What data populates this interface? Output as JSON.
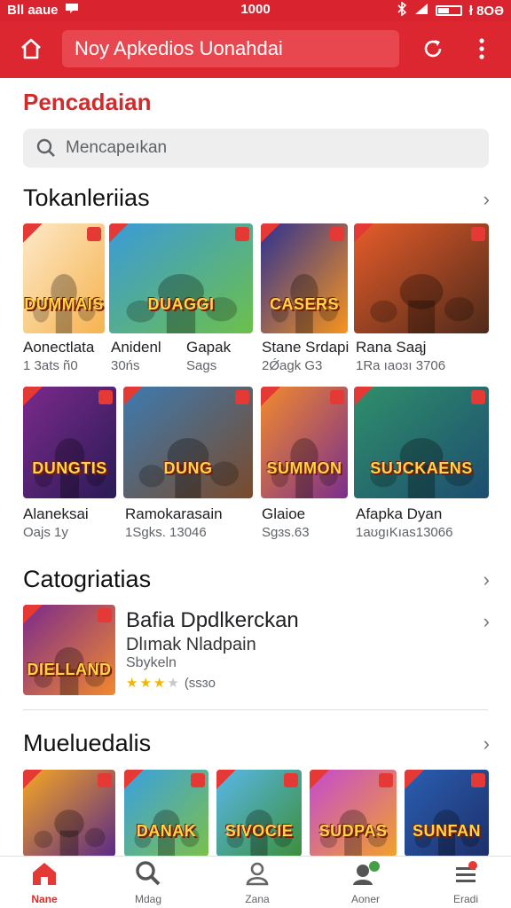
{
  "status_bar": {
    "carrier": "Bll aaue",
    "time": "1000",
    "battery_text": "ł 8OƏ"
  },
  "toolbar": {
    "url_text": "Noy Apkedios Uonahdai"
  },
  "page": {
    "title": "Pencadaian"
  },
  "search": {
    "placeholder": "Mencapeıkan"
  },
  "sections": {
    "top": {
      "title": "Tokanleriias"
    },
    "categories": {
      "title": "Catogriatias"
    },
    "more": {
      "title": "Mueluedalis"
    }
  },
  "apps_row1": [
    {
      "name": "Aonectlata",
      "meta": "1 3ats ñ0",
      "tile_text": "DUMMAIS",
      "colors": [
        "#fde9c8",
        "#f6b34f"
      ]
    },
    {
      "name": "Anidenl",
      "meta": "30ńs",
      "tile_text": "DUAGGI",
      "colors": [
        "#3a9ad9",
        "#6cc04a"
      ]
    },
    {
      "name": "Gapak",
      "meta": "Sags",
      "tile_text": "",
      "colors": [
        "#3a9ad9",
        "#6cc04a"
      ]
    },
    {
      "name": "Stane Srdapi",
      "meta": "2Ǿagk G3",
      "tile_text": "CASERS",
      "colors": [
        "#2e3192",
        "#f7941d"
      ]
    },
    {
      "name": "Rana Saąj",
      "meta": "1Ra ıaoɜı 3706",
      "tile_text": "",
      "colors": [
        "#e65c2a",
        "#4e2a1a"
      ]
    }
  ],
  "apps_row2": [
    {
      "name": "Alaneksai",
      "meta": "Oajs 1y",
      "tile_text": "DUNGTIS",
      "colors": [
        "#7b2a8c",
        "#2a1b55"
      ]
    },
    {
      "name": "Ramokarasain",
      "meta": "1Sgks. 13046",
      "tile_text": "DUNG",
      "colors": [
        "#3d7bb0",
        "#7a4a2a"
      ]
    },
    {
      "name": "Glaioe",
      "meta": "Sgɜs.63",
      "tile_text": "SUMMON",
      "colors": [
        "#f28a2e",
        "#7b2f8c"
      ]
    },
    {
      "name": "Afapka Dyan",
      "meta": "1aʊgıKıas13066",
      "tile_text": "SUJCKAENS",
      "colors": [
        "#2f8f6a",
        "#1d4d70"
      ]
    }
  ],
  "featured": {
    "name": "Bafia Dpdlkerckan",
    "subtitle": "Dlımak Nladpain",
    "category": "Sbykeln",
    "rating_text": "(ssɜo",
    "thumb_text": "DIELLAND",
    "rating": 3
  },
  "apps_row3": [
    {
      "tile_text": "",
      "colors": [
        "#f6a623",
        "#5a2a86"
      ]
    },
    {
      "tile_text": "DANAK",
      "colors": [
        "#3aa0e0",
        "#7cc04a"
      ]
    },
    {
      "tile_text": "SIVOCIE",
      "colors": [
        "#58b7e8",
        "#3c8f3a"
      ]
    },
    {
      "tile_text": "SUDPAS",
      "colors": [
        "#c44bd0",
        "#f1a12b"
      ]
    },
    {
      "tile_text": "SUNFAN",
      "colors": [
        "#2a5fb0",
        "#1d2f6b"
      ]
    }
  ],
  "bottom_nav": [
    {
      "label": "Nane",
      "icon": "home-icon",
      "active": true
    },
    {
      "label": "Mdag",
      "icon": "search-icon",
      "active": false
    },
    {
      "label": "Zana",
      "icon": "user-icon",
      "active": false
    },
    {
      "label": "Aoner",
      "icon": "account-add-icon",
      "active": false
    },
    {
      "label": "Eradi",
      "icon": "menu-icon",
      "active": false
    }
  ],
  "colors": {
    "brand": "#dc2630",
    "accent_title": "#d32b2b"
  }
}
